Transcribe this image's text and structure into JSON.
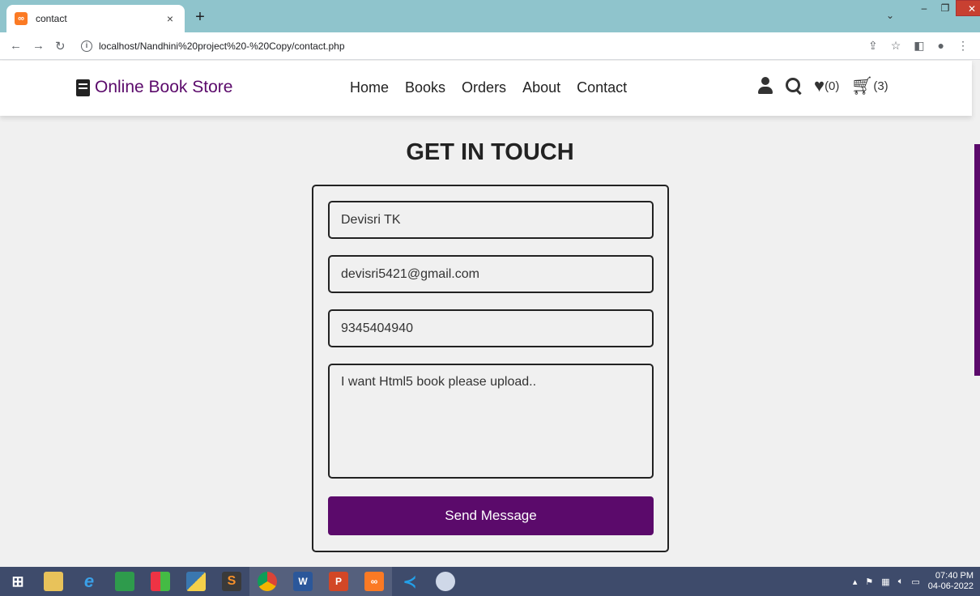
{
  "browser": {
    "tab_title": "contact",
    "tab_close": "×",
    "new_tab": "+",
    "url": "localhost/Nandhini%20project%20-%20Copy/contact.php"
  },
  "site": {
    "brand": "Online Book Store",
    "menu": [
      "Home",
      "Books",
      "Orders",
      "About",
      "Contact"
    ],
    "wishlist_count": "(0)",
    "cart_count": "(3)"
  },
  "contact": {
    "heading": "GET IN TOUCH",
    "name_value": "Devisri TK",
    "email_value": "devisri5421@gmail.com",
    "phone_value": "9345404940",
    "message_value": "I want Html5 book please upload..",
    "send_label": "Send Message"
  },
  "taskbar": {
    "time": "07:40 PM",
    "date": "04-06-2022"
  },
  "colors": {
    "accent": "#5b0a6b",
    "tabbar": "#8fc4cc",
    "taskbar": "#3e4b6b"
  }
}
